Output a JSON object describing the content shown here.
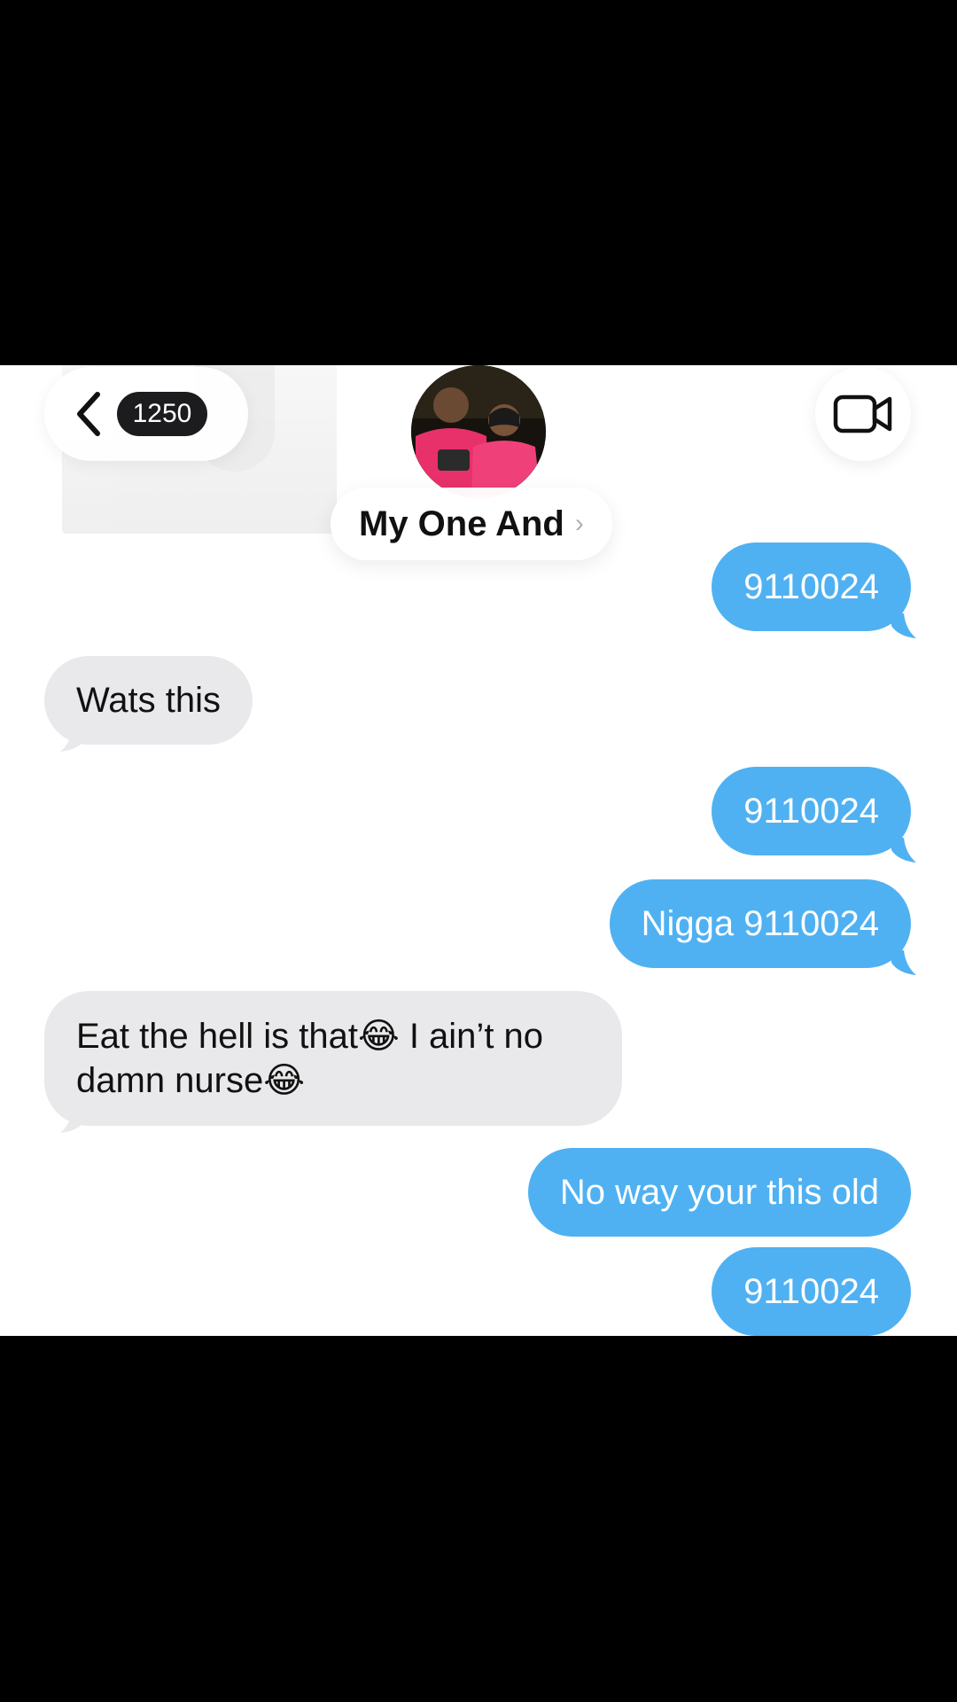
{
  "header": {
    "unread_count": "1250",
    "contact_name": "My One And",
    "name_chevron": "›",
    "back_icon": "chevron-left-icon",
    "video_icon": "video-camera-icon"
  },
  "messages": [
    {
      "dir": "out",
      "text": "9110024"
    },
    {
      "dir": "in",
      "text": "Wats this"
    },
    {
      "dir": "out",
      "text": "9110024"
    },
    {
      "dir": "out",
      "text": "Nigga 9110024"
    },
    {
      "dir": "in",
      "text": "Eat the hell is that😂 I ain’t no damn nurse😂"
    },
    {
      "dir": "out",
      "text": "No way your this old"
    },
    {
      "dir": "out",
      "text": "9110024"
    }
  ],
  "colors": {
    "outgoing_bubble": "#4fb1f2",
    "incoming_bubble": "#e9e9eb",
    "badge": "#1c1c1e"
  }
}
